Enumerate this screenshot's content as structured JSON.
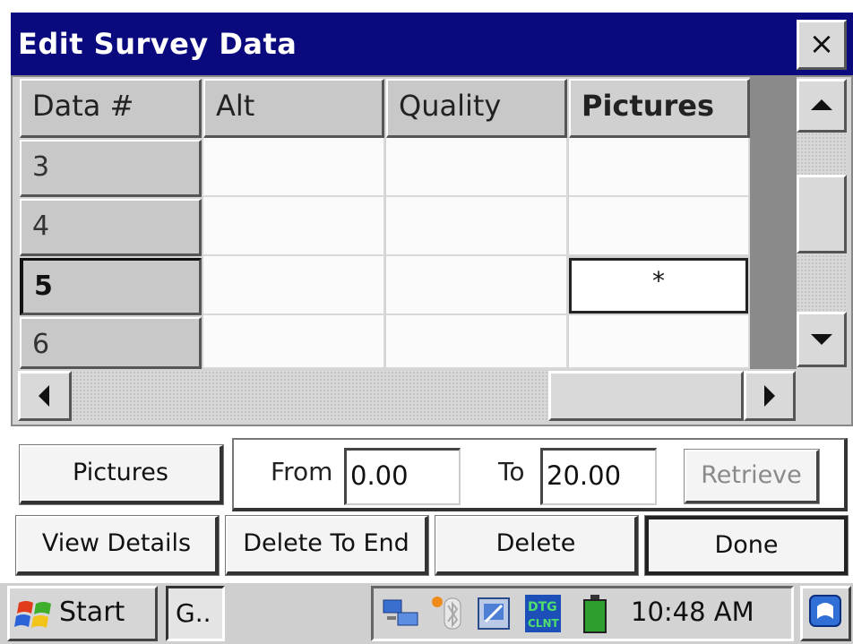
{
  "window": {
    "title": "Edit Survey Data",
    "close_glyph": "×"
  },
  "table": {
    "columns": [
      "Data #",
      "Alt",
      "Quality",
      "Pictures"
    ],
    "selected_column": "Pictures",
    "rows": [
      {
        "id": "3",
        "alt": "",
        "quality": "",
        "pictures": ""
      },
      {
        "id": "4",
        "alt": "",
        "quality": "",
        "pictures": ""
      },
      {
        "id": "5",
        "alt": "",
        "quality": "",
        "pictures": "*"
      },
      {
        "id": "6",
        "alt": "",
        "quality": "",
        "pictures": ""
      }
    ],
    "current_row": "5"
  },
  "range": {
    "from_label": "From",
    "from_value": "0.00",
    "to_label": "To",
    "to_value": "20.00",
    "retrieve_label": "Retrieve"
  },
  "buttons": {
    "pictures": "Pictures",
    "view_details": "View Details",
    "delete_to_end": "Delete To End",
    "delete": "Delete",
    "done": "Done"
  },
  "taskbar": {
    "start_label": "Start",
    "task_label": "G..",
    "clock": "10:48 AM",
    "tray_icons": [
      "network-icon",
      "bluetooth-icon",
      "sync-icon",
      "dtg-icon",
      "battery-icon"
    ]
  },
  "colors": {
    "title_bar": "#0a0a7e",
    "grid_dark": "#8a8a8a",
    "battery": "#2e9e2e"
  }
}
